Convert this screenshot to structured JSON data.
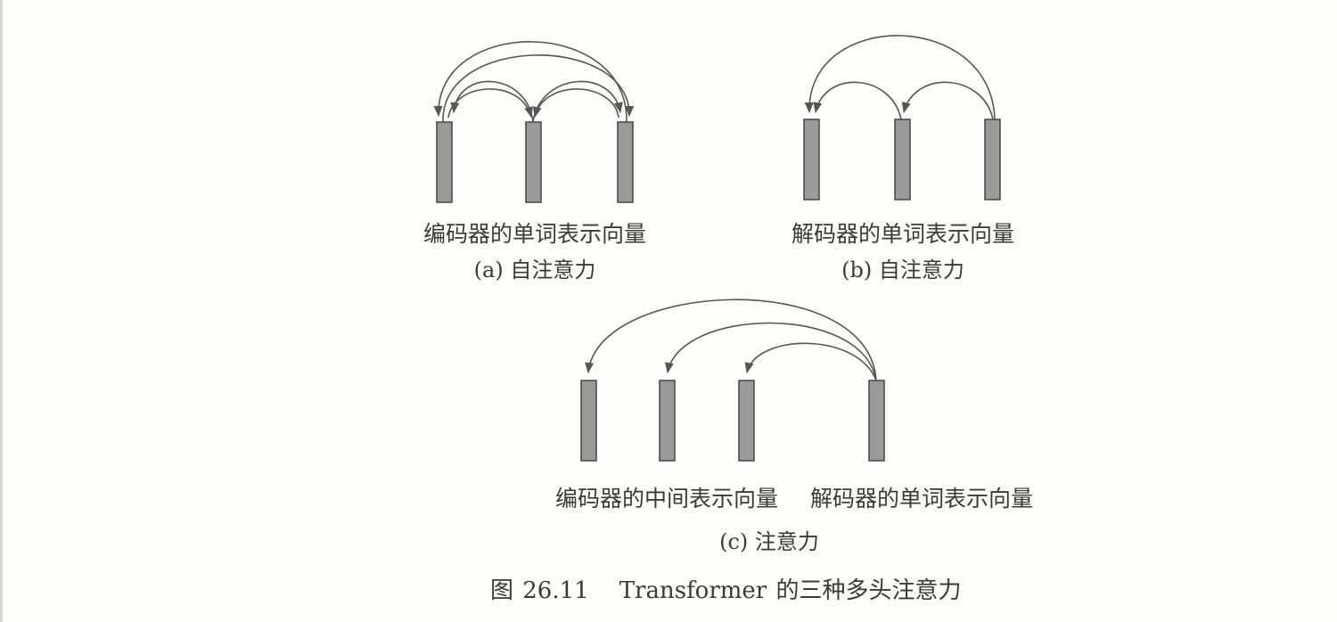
{
  "panel_a": {
    "label": "编码器的单词表示向量",
    "caption": "(a) 自注意力"
  },
  "panel_b": {
    "label": "解码器的单词表示向量",
    "caption": "(b) 自注意力"
  },
  "panel_c": {
    "label_left": "编码器的中间表示向量",
    "label_right": "解码器的单词表示向量",
    "caption": "(c) 注意力"
  },
  "figure": {
    "number": "图 26.11",
    "title": "Transformer 的三种多头注意力"
  },
  "colors": {
    "bar_fill": "#9a9a9a",
    "bar_stroke": "#444444",
    "arc_stroke": "#555555"
  }
}
